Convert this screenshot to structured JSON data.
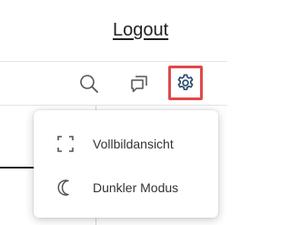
{
  "header": {
    "logout_label": "Logout"
  },
  "toolbar": {
    "icons": [
      "search-icon",
      "comments-icon",
      "settings-icon"
    ]
  },
  "settings_menu": {
    "items": [
      {
        "label": "Vollbildansicht",
        "icon": "fullscreen-icon"
      },
      {
        "label": "Dunkler Modus",
        "icon": "moon-icon"
      }
    ]
  },
  "colors": {
    "accent_highlight": "#e04a4a",
    "settings_icon": "#2a4a6e",
    "text": "#333333"
  }
}
